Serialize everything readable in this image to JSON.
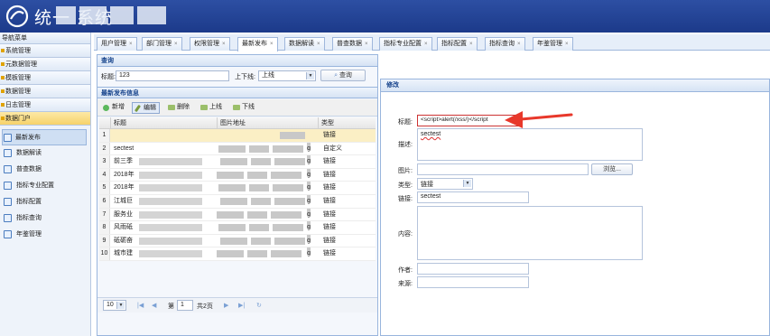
{
  "header": {
    "title": "统一 系统"
  },
  "sidebar": {
    "title": "导航菜单",
    "groups": [
      "系统管理",
      "元数据管理",
      "模板管理",
      "数据管理",
      "日志管理",
      "数据门户"
    ],
    "items": [
      "最新发布",
      "数据解读",
      "普查数据",
      "指标专业配置",
      "指标配置",
      "指标查询",
      "年鉴管理"
    ]
  },
  "tabs": [
    "用户管理",
    "部门管理",
    "权限管理",
    "最新发布",
    "数据解读",
    "普查数据",
    "指标专业配置",
    "指标配置",
    "指标查询",
    "年鉴管理"
  ],
  "tab_close": "×",
  "query": {
    "panel_title": "查询",
    "title_label": "标题:",
    "title_value": "123",
    "status_label": "上下线:",
    "status_value": "上线",
    "search_button": "查询"
  },
  "grid": {
    "title": "最新发布信息",
    "toolbar": [
      "新增",
      "编辑",
      "删除",
      "上线",
      "下线"
    ],
    "columns": [
      "标题",
      "图片地址",
      "类型"
    ],
    "rows": [
      {
        "n": "1",
        "title": "",
        "suffix": "",
        "type": "链接"
      },
      {
        "n": "2",
        "title": "sectest",
        "suffix": "g",
        "type": "自定义"
      },
      {
        "n": "3",
        "title": "前三季",
        "suffix": "g",
        "type": "链接"
      },
      {
        "n": "4",
        "title": "2018年",
        "suffix": "g",
        "type": "链接"
      },
      {
        "n": "5",
        "title": "2018年",
        "suffix": "g",
        "type": "链接"
      },
      {
        "n": "6",
        "title": "江城巨",
        "suffix": "g",
        "type": "链接"
      },
      {
        "n": "7",
        "title": "服务业",
        "suffix": "g",
        "type": "链接"
      },
      {
        "n": "8",
        "title": "风雨砥",
        "suffix": "g",
        "type": "链接"
      },
      {
        "n": "9",
        "title": "砥砺奋",
        "suffix": "g",
        "type": "链接"
      },
      {
        "n": "10",
        "title": "城市建",
        "suffix": "g",
        "type": "链接"
      }
    ],
    "pager": {
      "page_size": "10",
      "page_prefix": "第",
      "page": "1",
      "total": "共2页"
    }
  },
  "dialog": {
    "title": "修改",
    "title_label": "标题:",
    "title_value": "<script>alert(/xss/)</script",
    "desc_label": "描述:",
    "desc_value": "sectest",
    "image_label": "图片:",
    "image_value": "",
    "browse_button": "浏览...",
    "type_label": "类型:",
    "type_value": "链接",
    "link_label": "链接:",
    "link_value": "sectest",
    "content_label": "内容:",
    "author_label": "作者:",
    "source_label": "来源:"
  },
  "colors": {
    "header": "#1c3a8a",
    "accent": "#15428b",
    "arrow": "#e8382b",
    "selected_row": "#fbefc5"
  },
  "icons": [
    "app-logo-icon",
    "close-icon",
    "search-icon",
    "add-icon",
    "edit-icon",
    "delete-icon",
    "online-icon",
    "offline-icon",
    "chevron-down-icon",
    "page-first-icon",
    "page-prev-icon",
    "page-next-icon",
    "page-last-icon",
    "refresh-icon"
  ]
}
